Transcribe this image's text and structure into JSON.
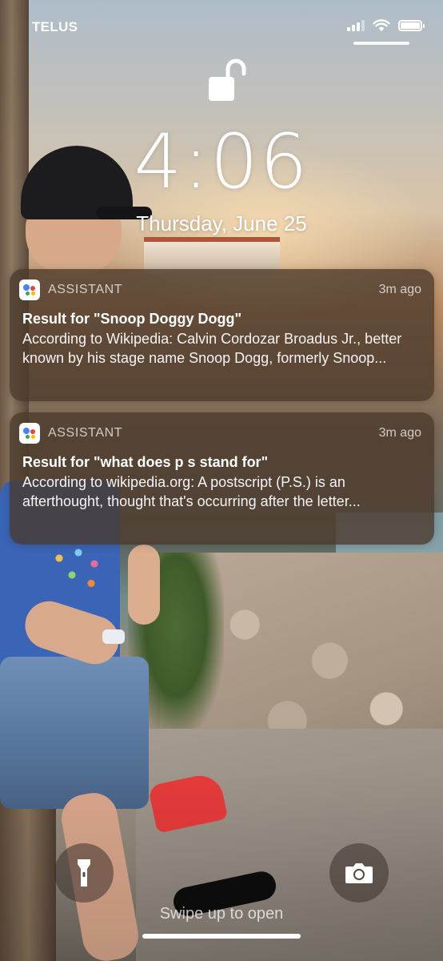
{
  "status_bar": {
    "carrier": "TELUS",
    "signal_bars_filled": 3,
    "signal_bars_total": 4,
    "wifi_icon": "wifi-icon",
    "battery_icon": "battery-icon"
  },
  "lock_screen": {
    "lock_icon": "unlocked-padlock-icon",
    "time": "4:06",
    "date": "Thursday, June 25"
  },
  "notifications": [
    {
      "app_name": "ASSISTANT",
      "app_icon": "google-assistant-icon",
      "time_ago": "3m ago",
      "title": "Result for \"Snoop Doggy Dogg\"",
      "body": "According to Wikipedia: Calvin Cordozar Broadus Jr., better known by his stage name Snoop Dogg, formerly Snoop..."
    },
    {
      "app_name": "ASSISTANT",
      "app_icon": "google-assistant-icon",
      "time_ago": "3m ago",
      "title": "Result for \"what does p s stand for\"",
      "body": "According to wikipedia.org: A postscript (P.S.) is an afterthought, thought that's occurring after the letter..."
    }
  ],
  "bottom": {
    "flashlight_icon": "flashlight-icon",
    "camera_icon": "camera-icon",
    "swipe_hint": "Swipe up to open"
  },
  "colors": {
    "assistant_blue": "#4285F4",
    "assistant_red": "#EA4335",
    "assistant_yellow": "#FBBC05",
    "assistant_green": "#34A853"
  }
}
